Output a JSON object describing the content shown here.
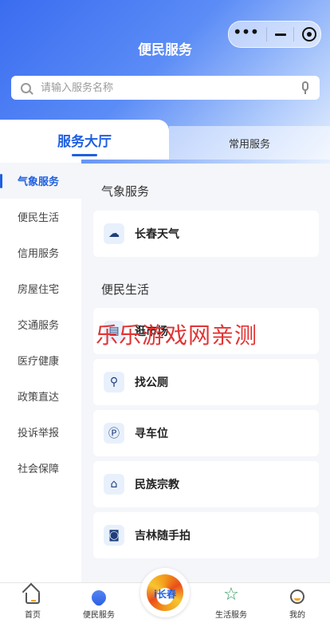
{
  "header": {
    "title": "便民服务",
    "capsule": {
      "more_icon": "more-dots-icon",
      "minimize_icon": "minimize-icon",
      "close_icon": "target-circle-icon"
    }
  },
  "search": {
    "placeholder": "请输入服务名称",
    "value": "",
    "icon": "search-icon",
    "voice_icon": "mic-icon"
  },
  "tabs": [
    {
      "label": "服务大厅",
      "active": true
    },
    {
      "label": "常用服务",
      "active": false
    }
  ],
  "sidebar": {
    "items": [
      {
        "label": "气象服务",
        "active": true
      },
      {
        "label": "便民生活"
      },
      {
        "label": "信用服务"
      },
      {
        "label": "房屋住宅"
      },
      {
        "label": "交通服务"
      },
      {
        "label": "医疗健康"
      },
      {
        "label": "政策直达"
      },
      {
        "label": "投诉举报"
      },
      {
        "label": "社会保障"
      }
    ]
  },
  "sections": [
    {
      "title": "气象服务",
      "items": [
        {
          "label": "长春天气",
          "icon": "weather-icon"
        }
      ]
    },
    {
      "title": "便民生活",
      "items": [
        {
          "label": "逛市场",
          "icon": "market-icon"
        },
        {
          "label": "找公厕",
          "icon": "restroom-icon"
        },
        {
          "label": "寻车位",
          "icon": "parking-icon"
        },
        {
          "label": "民族宗教",
          "icon": "temple-icon"
        },
        {
          "label": "吉林随手拍",
          "icon": "camera-icon"
        }
      ]
    }
  ],
  "watermark": "乐乐游戏网亲测",
  "bottom_nav": [
    {
      "label": "首页",
      "icon": "home-icon"
    },
    {
      "label": "便民服务",
      "icon": "heart-icon"
    },
    {
      "label": "i长春",
      "icon": "ichangchun-logo"
    },
    {
      "label": "生活服务",
      "icon": "star-icon"
    },
    {
      "label": "我的",
      "icon": "profile-icon"
    }
  ],
  "colors": {
    "accent": "#1f5fe0",
    "watermark": "#e23434",
    "header_gradient_start": "#3a6cf0"
  }
}
